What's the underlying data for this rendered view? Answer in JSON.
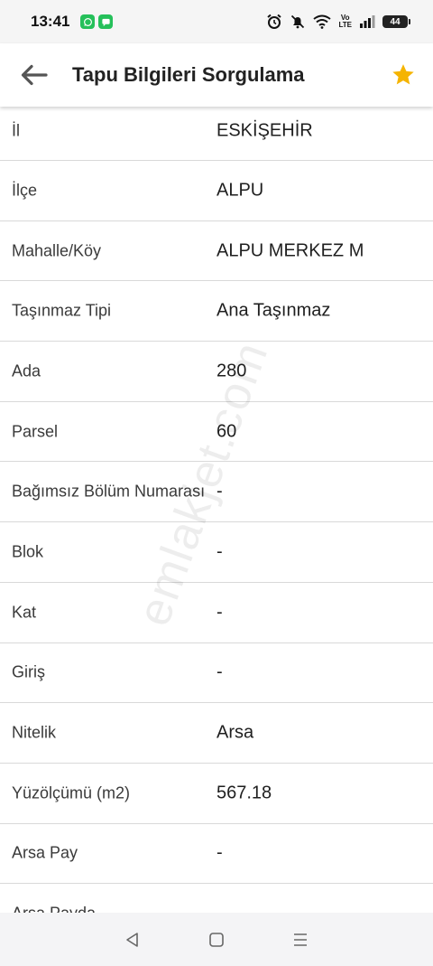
{
  "status_bar": {
    "time": "13:41",
    "volte_line1": "Vo",
    "volte_line2": "LTE",
    "battery": "44"
  },
  "header": {
    "title": "Tapu Bilgileri Sorgulama"
  },
  "rows": [
    {
      "label": "İl",
      "value": "ESKİŞEHİR"
    },
    {
      "label": "İlçe",
      "value": "ALPU"
    },
    {
      "label": "Mahalle/Köy",
      "value": "ALPU MERKEZ M"
    },
    {
      "label": "Taşınmaz Tipi",
      "value": "Ana Taşınmaz"
    },
    {
      "label": "Ada",
      "value": "280"
    },
    {
      "label": "Parsel",
      "value": "60"
    },
    {
      "label": "Bağımsız Bölüm Numarası",
      "value": "-"
    },
    {
      "label": "Blok",
      "value": "-"
    },
    {
      "label": "Kat",
      "value": "-"
    },
    {
      "label": "Giriş",
      "value": "-"
    },
    {
      "label": "Nitelik",
      "value": "Arsa"
    },
    {
      "label": "Yüzölçümü (m2)",
      "value": "567.18"
    },
    {
      "label": "Arsa Pay",
      "value": "-"
    },
    {
      "label": "Arsa Payda",
      "value": ""
    }
  ],
  "watermark": "emlakjet.com",
  "colors": {
    "star": "#f5b400",
    "back_arrow": "#555555",
    "divider": "#d9d9d9",
    "app_icon": "#25c05a"
  },
  "icons": {
    "back": "arrow-left-icon",
    "favorite": "star-icon",
    "nav_back": "triangle-back-icon",
    "nav_home": "square-home-icon",
    "nav_menu": "menu-lines-icon"
  }
}
